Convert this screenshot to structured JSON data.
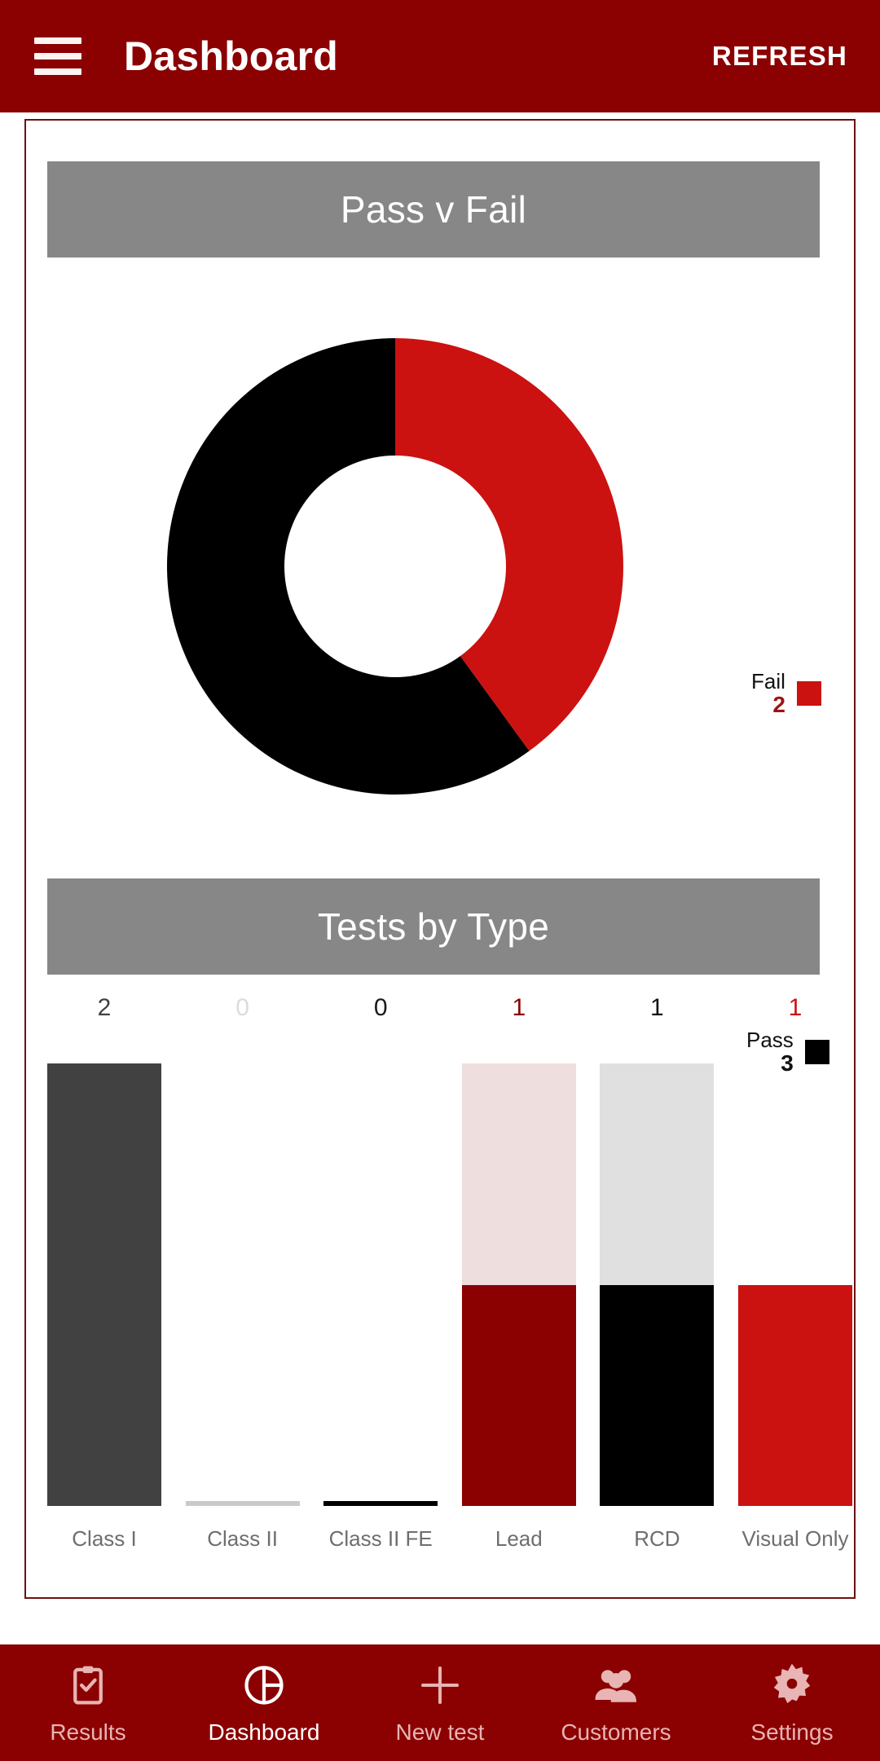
{
  "appbar": {
    "menu_icon": "hamburger-menu-icon",
    "title": "Dashboard",
    "action_label": "REFRESH",
    "background": "#8b0000"
  },
  "sections": {
    "pass_v_fail": {
      "title": "Pass v Fail",
      "header_background": "#878787"
    },
    "tests_by_type": {
      "title": "Tests by Type",
      "header_background": "#878787"
    }
  },
  "chart_data": [
    {
      "type": "pie",
      "title": "Pass v Fail",
      "donut": true,
      "legend_position": "right",
      "labels": [
        "Fail",
        "Pass"
      ],
      "values": [
        2,
        3
      ],
      "colors": [
        "#cc1111",
        "#000000"
      ],
      "slices": [
        {
          "label": "Fail",
          "value": 2,
          "color": "#cc1111",
          "percent": 40
        },
        {
          "label": "Pass",
          "value": 3,
          "color": "#000000",
          "percent": 60
        }
      ],
      "legend": [
        {
          "name": "Fail",
          "value": "2",
          "color": "#cc1111",
          "value_color": "#9b1414"
        },
        {
          "name": "Pass",
          "value": "3",
          "color": "#000000",
          "value_color": "#111111"
        }
      ]
    },
    {
      "type": "bar",
      "title": "Tests by Type",
      "xlabel": "",
      "ylabel": "",
      "grid": false,
      "ylim": [
        0,
        2
      ],
      "categories": [
        "Class I",
        "Class II",
        "Class II FE",
        "Lead",
        "RCD",
        "Visual Only"
      ],
      "values": [
        2,
        0,
        0,
        1,
        1,
        1
      ],
      "value_labels": [
        "2",
        "0",
        "0",
        "1",
        "1",
        "1"
      ],
      "bars": [
        {
          "category": "Class I",
          "value": 2,
          "label": "2",
          "fill_color": "#414141",
          "track_color": "#dcdcdc",
          "label_color": "#414141",
          "fill_fraction": 1.0,
          "track_visible": false
        },
        {
          "category": "Class II",
          "value": 0,
          "label": "0",
          "fill_color": "#c9c9c9",
          "track_color": "#c9c9c9",
          "label_color": "#dcdcdc",
          "fill_fraction": 0.0,
          "track_visible": false
        },
        {
          "category": "Class II FE",
          "value": 0,
          "label": "0",
          "fill_color": "#000000",
          "track_color": "#000000",
          "label_color": "#1a1a1a",
          "fill_fraction": 0.0,
          "track_visible": false
        },
        {
          "category": "Lead",
          "value": 1,
          "label": "1",
          "fill_color": "#8b0000",
          "track_color": "#eedede",
          "label_color": "#8b0000",
          "fill_fraction": 0.5,
          "track_visible": true
        },
        {
          "category": "RCD",
          "value": 1,
          "label": "1",
          "fill_color": "#000000",
          "track_color": "#e0e0e0",
          "label_color": "#111111",
          "fill_fraction": 0.5,
          "track_visible": true
        },
        {
          "category": "Visual Only",
          "value": 1,
          "label": "1",
          "fill_color": "#cc1111",
          "track_color": "#f9dedе",
          "label_color": "#cc1111",
          "fill_fraction": 0.5,
          "track_visible": true
        }
      ]
    }
  ],
  "bottom_nav": {
    "background": "#8b0000",
    "items": [
      {
        "label": "Results",
        "icon": "clipboard-check-icon",
        "active": false
      },
      {
        "label": "Dashboard",
        "icon": "pie-chart-icon",
        "active": true
      },
      {
        "label": "New test",
        "icon": "plus-icon",
        "active": false
      },
      {
        "label": "Customers",
        "icon": "people-group-icon",
        "active": false
      },
      {
        "label": "Settings",
        "icon": "gear-icon",
        "active": false
      }
    ]
  }
}
